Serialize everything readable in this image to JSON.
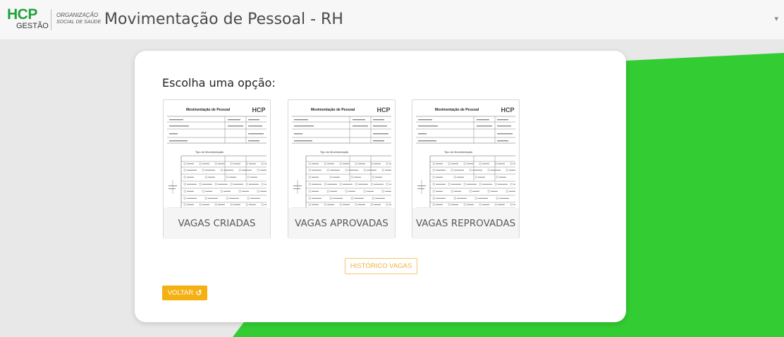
{
  "header": {
    "logo_brand": "HCP",
    "logo_sub": "GESTÃO",
    "org_line1": "ORGANIZAÇÃO",
    "org_line2": "SOCIAL DE SAÚDE",
    "title": "Movimentação de Pessoal - RH",
    "user_menu": "  ▾"
  },
  "main": {
    "prompt": "Escolha uma opção:",
    "options": [
      {
        "label": "VAGAS CRIADAS"
      },
      {
        "label": "VAGAS APROVADAS"
      },
      {
        "label": "VAGAS REPROVADAS"
      }
    ],
    "thumb_title": "Movimentação de Pessoal",
    "thumb_section": "Tipo de Movimentação",
    "history_button": "HISTÓRICO VAGAS",
    "back_button": "VOLTAR",
    "back_icon": "refresh-icon"
  },
  "colors": {
    "green": "#33cc33",
    "brand_green": "#1fa33a",
    "accent": "#f5b014"
  }
}
